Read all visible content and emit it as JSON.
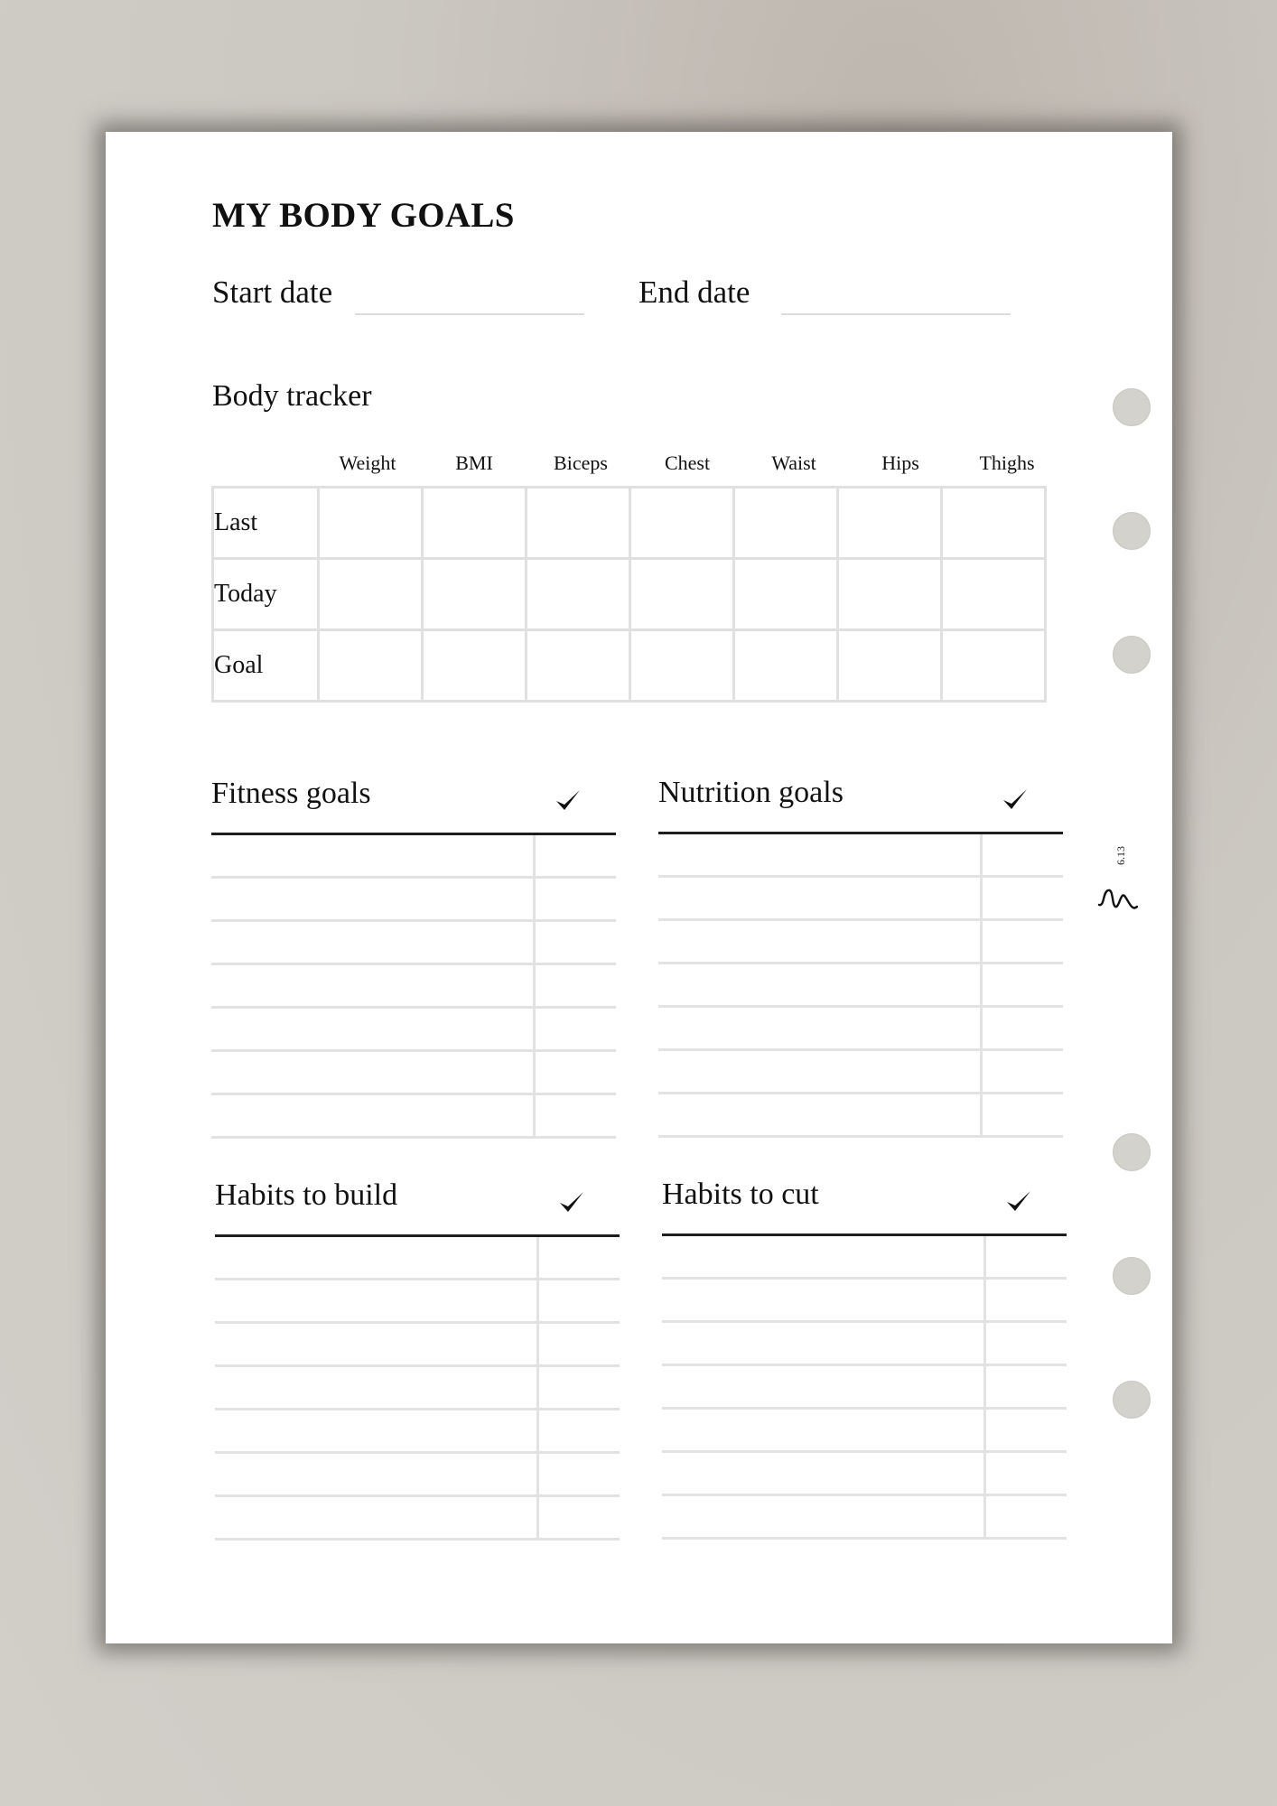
{
  "page": {
    "title": "MY BODY GOALS",
    "start_date": {
      "label": "Start date",
      "value": ""
    },
    "end_date": {
      "label": "End date",
      "value": ""
    }
  },
  "body_tracker": {
    "heading": "Body tracker",
    "columns": [
      "Weight",
      "BMI",
      "Biceps",
      "Chest",
      "Waist",
      "Hips",
      "Thighs"
    ],
    "rows": [
      {
        "label": "Last",
        "values": [
          "",
          "",
          "",
          "",
          "",
          "",
          ""
        ]
      },
      {
        "label": "Today",
        "values": [
          "",
          "",
          "",
          "",
          "",
          "",
          ""
        ]
      },
      {
        "label": "Goal",
        "values": [
          "",
          "",
          "",
          "",
          "",
          "",
          ""
        ]
      }
    ]
  },
  "sections": [
    {
      "heading": "Fitness goals",
      "check_icon": "checkmark",
      "line_count": 7
    },
    {
      "heading": "Nutrition goals",
      "check_icon": "checkmark",
      "line_count": 7
    },
    {
      "heading": "Habits to build",
      "check_icon": "checkmark",
      "line_count": 7
    },
    {
      "heading": "Habits to cut",
      "check_icon": "checkmark",
      "line_count": 7
    }
  ],
  "branding": {
    "signature_icon": "signature-logo",
    "page_code": "6.13"
  },
  "binder_holes": 6,
  "colors": {
    "hole": "#d4d2cc",
    "grid_line": "#e0e0e0",
    "rule_dark": "#1e1e1e",
    "background": "#cbc7c1"
  }
}
